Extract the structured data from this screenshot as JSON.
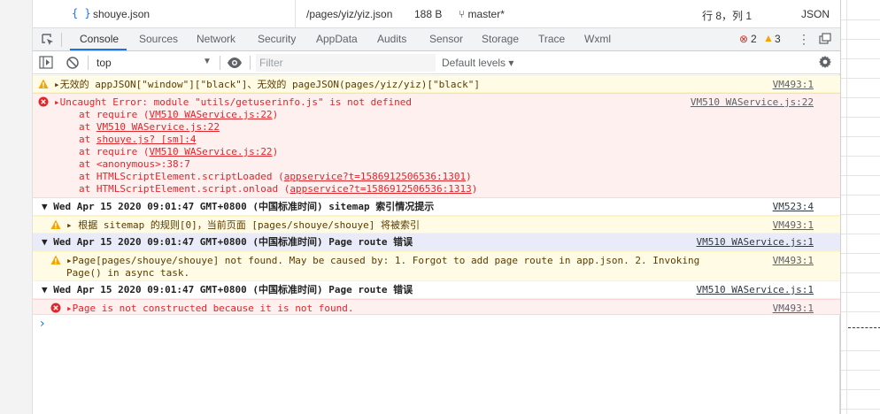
{
  "editor": {
    "file_icon": "{ }",
    "file_name": "shouye.json",
    "path": "/pages/yiz/yiz.json",
    "size": "188 B",
    "branch": "master*",
    "cursor": "行 8，列 1",
    "language": "JSON"
  },
  "tabs": [
    "Console",
    "Sources",
    "Network",
    "Security",
    "AppData",
    "Audits",
    "Sensor",
    "Storage",
    "Trace",
    "Wxml"
  ],
  "active_tab": "Console",
  "badges": {
    "errors": "2",
    "warnings": "3"
  },
  "toolbar": {
    "context": "top",
    "filter_placeholder": "Filter",
    "levels": "Default levels ▾"
  },
  "messages": {
    "m1": {
      "text": "▸无效的 appJSON[\"window\"][\"black\"]、无效的 pageJSON(pages/yiz/yiz)[\"black\"]",
      "source": "VM493:1"
    },
    "m2": {
      "text": "▸Uncaught Error: module \"utils/getuserinfo.js\" is not defined",
      "source": "VM510 WAService.js:22",
      "stack": [
        {
          "pre": "at require (",
          "link": "VM510 WAService.js:22",
          "post": ")"
        },
        {
          "pre": "at ",
          "link": "VM510 WAService.js:22",
          "post": ""
        },
        {
          "pre": "at ",
          "link": "shouye.js? [sm]:4",
          "post": ""
        },
        {
          "pre": "at require (",
          "link": "VM510 WAService.js:22",
          "post": ")"
        },
        {
          "pre": "at <anonymous>:38:7",
          "link": "",
          "post": ""
        },
        {
          "pre": "at HTMLScriptElement.scriptLoaded (",
          "link": "appservice?t=1586912506536:1301",
          "post": ")"
        },
        {
          "pre": "at HTMLScriptElement.script.onload (",
          "link": "appservice?t=1586912506536:1313",
          "post": ")"
        }
      ]
    },
    "g1": {
      "text": "▼ Wed Apr 15 2020 09:01:47 GMT+0800 (中国标准时间) sitemap 索引情况提示",
      "source": "VM523:4"
    },
    "m3": {
      "text": "▸ 根据 sitemap 的规则[0]，当前页面 [pages/shouye/shouye] 将被索引",
      "source": "VM493:1"
    },
    "g2": {
      "text": "▼ Wed Apr 15 2020 09:01:47 GMT+0800 (中国标准时间) Page route 错误",
      "source": "VM510 WAService.js:1"
    },
    "m4": {
      "line1": "▸Page[pages/shouye/shouye] not found. May be caused by: 1. Forgot to add page route in app.json. 2. Invoking",
      "line2": "Page() in async task.",
      "source": "VM493:1"
    },
    "g3": {
      "text": "▼ Wed Apr 15 2020 09:01:47 GMT+0800 (中国标准时间) Page route 错误",
      "source": "VM510 WAService.js:1"
    },
    "m5": {
      "text": "▸Page is not constructed because it is not found.",
      "source": "VM493:1"
    }
  },
  "prompt": "›"
}
